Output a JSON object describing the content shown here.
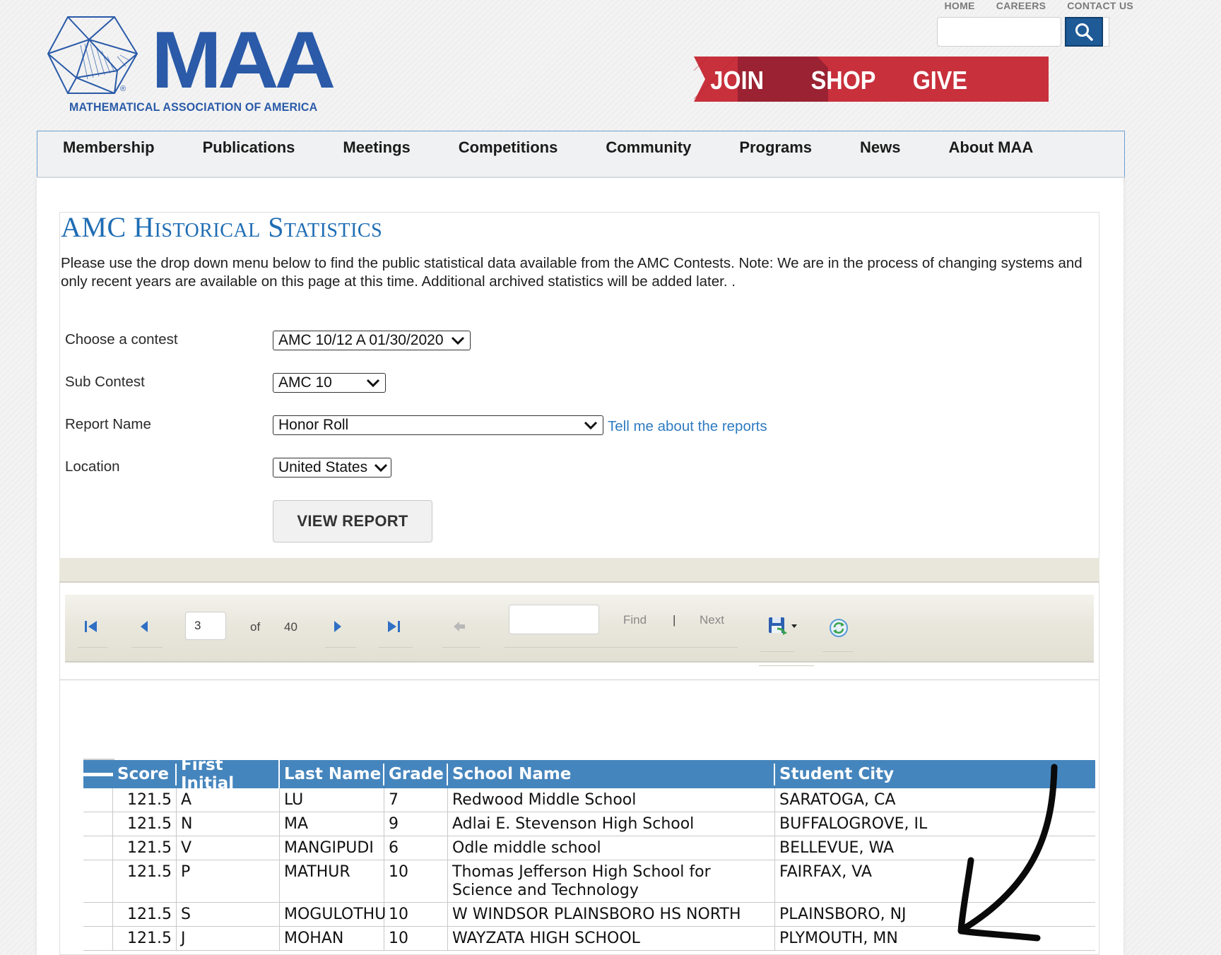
{
  "header": {
    "logo_text": "MAA",
    "logo_subtitle": "MATHEMATICAL ASSOCIATION OF AMERICA",
    "logo_reg": "®",
    "top_links": [
      "HOME",
      "CAREERS",
      "CONTACT US"
    ],
    "search_placeholder": "",
    "promo": [
      "JOIN",
      "SHOP",
      "GIVE"
    ]
  },
  "nav": [
    "Membership",
    "Publications",
    "Meetings",
    "Competitions",
    "Community",
    "Programs",
    "News",
    "About MAA"
  ],
  "page": {
    "title": "AMC Historical Statistics",
    "intro": "Please use the drop down menu below to find the public statistical data available from the AMC Contests. Note: We are in the process of changing systems and only recent years are available on this page at this time. Additional archived statistics will be added later. ."
  },
  "form": {
    "contest_label": "Choose a contest",
    "contest_value": "AMC 10/12 A 01/30/2020",
    "subcontest_label": "Sub Contest",
    "subcontest_value": "AMC 10",
    "report_label": "Report Name",
    "report_value": "Honor Roll",
    "report_help_link": "Tell me about the reports",
    "location_label": "Location",
    "location_value": "United States",
    "view_button": "VIEW REPORT"
  },
  "toolbar": {
    "current_page": "3",
    "of_label": "of",
    "total_pages": "40",
    "find_label": "Find",
    "separator": "|",
    "next_label": "Next",
    "find_value": ""
  },
  "table": {
    "headers": [
      "Score",
      "First Initial",
      "Last Name",
      "Grade",
      "School Name",
      "Student City"
    ],
    "rows": [
      [
        "121.5",
        "A",
        "LU",
        "7",
        "Redwood Middle School",
        "SARATOGA, CA"
      ],
      [
        "121.5",
        "N",
        "MA",
        "9",
        "Adlai E. Stevenson High School",
        "BUFFALOGROVE, IL"
      ],
      [
        "121.5",
        "V",
        "MANGIPUDI",
        "6",
        "Odle middle school",
        "BELLEVUE, WA"
      ],
      [
        "121.5",
        "P",
        "MATHUR",
        "10",
        "Thomas Jefferson High School for Science and Technology",
        "FAIRFAX, VA"
      ],
      [
        "121.5",
        "S",
        "MOGULOTHU",
        "10",
        "W WINDSOR PLAINSBORO HS NORTH",
        "PLAINSBORO, NJ"
      ],
      [
        "121.5",
        "J",
        "MOHAN",
        "10",
        "WAYZATA HIGH SCHOOL",
        "PLYMOUTH, MN"
      ]
    ]
  },
  "colors": {
    "brand_blue": "#2a5aa8",
    "title_blue": "#1f6db4",
    "table_header": "#4585bd",
    "promo_red": "#c8303c",
    "promo_dark_red": "#9b2232"
  },
  "icons": [
    "search-icon",
    "first-page-icon",
    "prev-page-icon",
    "next-page-icon",
    "last-page-icon",
    "back-icon",
    "save-icon",
    "refresh-icon",
    "arrow-annotation"
  ]
}
